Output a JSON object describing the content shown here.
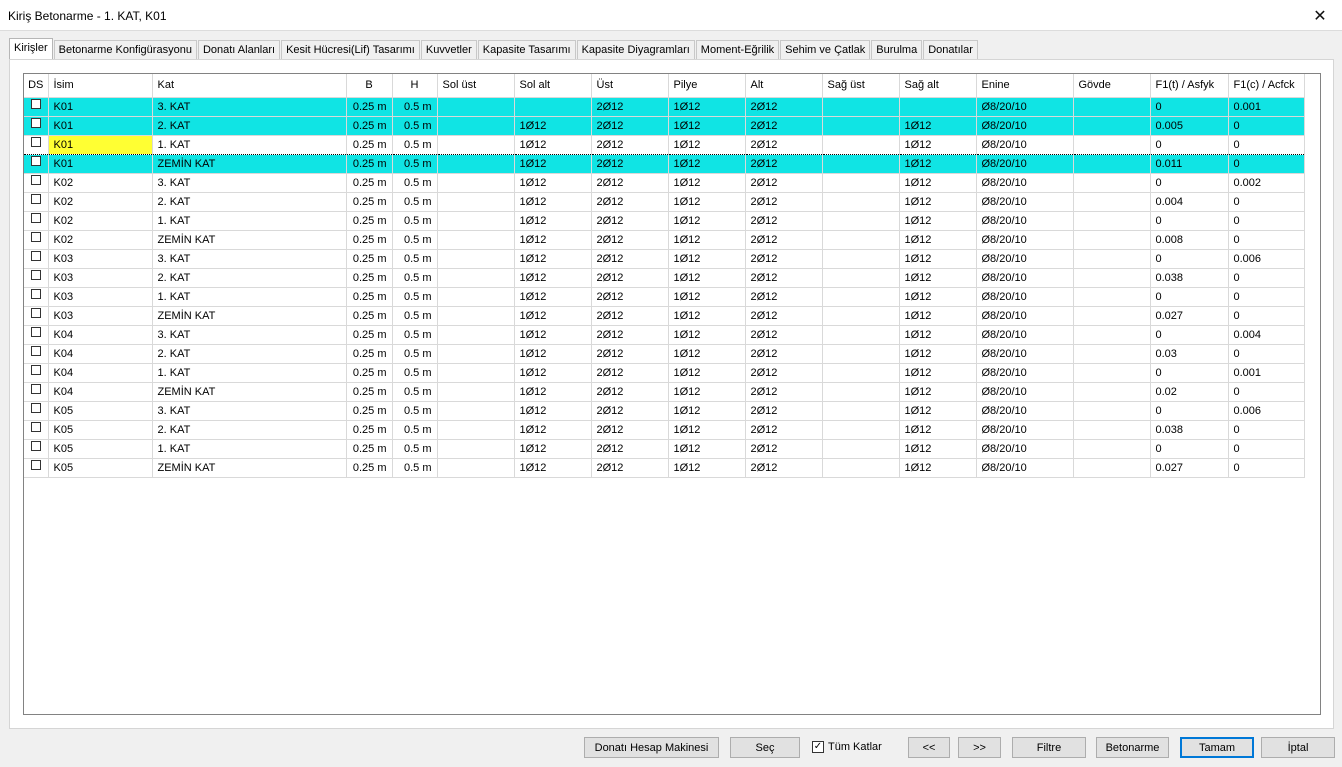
{
  "window": {
    "title": "Kiriş Betonarme - 1. KAT, K01",
    "close_glyph": "✕"
  },
  "tabs": [
    {
      "label": "Kirişler",
      "active": true
    },
    {
      "label": "Betonarme Konfigürasyonu"
    },
    {
      "label": "Donatı Alanları"
    },
    {
      "label": "Kesit Hücresi(Lif) Tasarımı"
    },
    {
      "label": "Kuvvetler"
    },
    {
      "label": "Kapasite Tasarımı"
    },
    {
      "label": "Kapasite Diyagramları"
    },
    {
      "label": "Moment-Eğrilik"
    },
    {
      "label": "Sehim ve Çatlak"
    },
    {
      "label": "Burulma"
    },
    {
      "label": "Donatılar"
    }
  ],
  "table": {
    "columns": [
      "DS",
      "İsim",
      "Kat",
      "B",
      "H",
      "Sol üst",
      "Sol alt",
      "Üst",
      "Pilye",
      "Alt",
      "Sağ üst",
      "Sağ alt",
      "Enine",
      "Gövde",
      "F1(t) / Asfyk",
      "F1(c) / Acfck"
    ],
    "rows": [
      {
        "hl": true,
        "cells": [
          "K01",
          "3. KAT",
          "0.25 m",
          "0.5 m",
          "",
          "",
          "2Ø12",
          "1Ø12",
          "2Ø12",
          "",
          "",
          "Ø8/20/10",
          "",
          "0",
          "0.001"
        ]
      },
      {
        "hl": true,
        "cells": [
          "K01",
          "2. KAT",
          "0.25 m",
          "0.5 m",
          "",
          "1Ø12",
          "2Ø12",
          "1Ø12",
          "2Ø12",
          "",
          "1Ø12",
          "Ø8/20/10",
          "",
          "0.005",
          "0"
        ]
      },
      {
        "cur": true,
        "cells": [
          "K01",
          "1. KAT",
          "0.25 m",
          "0.5 m",
          "",
          "1Ø12",
          "2Ø12",
          "1Ø12",
          "2Ø12",
          "",
          "1Ø12",
          "Ø8/20/10",
          "",
          "0",
          "0"
        ]
      },
      {
        "hl": true,
        "cells": [
          "K01",
          "ZEMİN KAT",
          "0.25 m",
          "0.5 m",
          "",
          "1Ø12",
          "2Ø12",
          "1Ø12",
          "2Ø12",
          "",
          "1Ø12",
          "Ø8/20/10",
          "",
          "0.011",
          "0"
        ]
      },
      {
        "cells": [
          "K02",
          "3. KAT",
          "0.25 m",
          "0.5 m",
          "",
          "1Ø12",
          "2Ø12",
          "1Ø12",
          "2Ø12",
          "",
          "1Ø12",
          "Ø8/20/10",
          "",
          "0",
          "0.002"
        ]
      },
      {
        "cells": [
          "K02",
          "2. KAT",
          "0.25 m",
          "0.5 m",
          "",
          "1Ø12",
          "2Ø12",
          "1Ø12",
          "2Ø12",
          "",
          "1Ø12",
          "Ø8/20/10",
          "",
          "0.004",
          "0"
        ]
      },
      {
        "cells": [
          "K02",
          "1. KAT",
          "0.25 m",
          "0.5 m",
          "",
          "1Ø12",
          "2Ø12",
          "1Ø12",
          "2Ø12",
          "",
          "1Ø12",
          "Ø8/20/10",
          "",
          "0",
          "0"
        ]
      },
      {
        "cells": [
          "K02",
          "ZEMİN KAT",
          "0.25 m",
          "0.5 m",
          "",
          "1Ø12",
          "2Ø12",
          "1Ø12",
          "2Ø12",
          "",
          "1Ø12",
          "Ø8/20/10",
          "",
          "0.008",
          "0"
        ]
      },
      {
        "cells": [
          "K03",
          "3. KAT",
          "0.25 m",
          "0.5 m",
          "",
          "1Ø12",
          "2Ø12",
          "1Ø12",
          "2Ø12",
          "",
          "1Ø12",
          "Ø8/20/10",
          "",
          "0",
          "0.006"
        ]
      },
      {
        "cells": [
          "K03",
          "2. KAT",
          "0.25 m",
          "0.5 m",
          "",
          "1Ø12",
          "2Ø12",
          "1Ø12",
          "2Ø12",
          "",
          "1Ø12",
          "Ø8/20/10",
          "",
          "0.038",
          "0"
        ]
      },
      {
        "cells": [
          "K03",
          "1. KAT",
          "0.25 m",
          "0.5 m",
          "",
          "1Ø12",
          "2Ø12",
          "1Ø12",
          "2Ø12",
          "",
          "1Ø12",
          "Ø8/20/10",
          "",
          "0",
          "0"
        ]
      },
      {
        "cells": [
          "K03",
          "ZEMİN KAT",
          "0.25 m",
          "0.5 m",
          "",
          "1Ø12",
          "2Ø12",
          "1Ø12",
          "2Ø12",
          "",
          "1Ø12",
          "Ø8/20/10",
          "",
          "0.027",
          "0"
        ]
      },
      {
        "cells": [
          "K04",
          "3. KAT",
          "0.25 m",
          "0.5 m",
          "",
          "1Ø12",
          "2Ø12",
          "1Ø12",
          "2Ø12",
          "",
          "1Ø12",
          "Ø8/20/10",
          "",
          "0",
          "0.004"
        ]
      },
      {
        "cells": [
          "K04",
          "2. KAT",
          "0.25 m",
          "0.5 m",
          "",
          "1Ø12",
          "2Ø12",
          "1Ø12",
          "2Ø12",
          "",
          "1Ø12",
          "Ø8/20/10",
          "",
          "0.03",
          "0"
        ]
      },
      {
        "cells": [
          "K04",
          "1. KAT",
          "0.25 m",
          "0.5 m",
          "",
          "1Ø12",
          "2Ø12",
          "1Ø12",
          "2Ø12",
          "",
          "1Ø12",
          "Ø8/20/10",
          "",
          "0",
          "0.001"
        ]
      },
      {
        "cells": [
          "K04",
          "ZEMİN KAT",
          "0.25 m",
          "0.5 m",
          "",
          "1Ø12",
          "2Ø12",
          "1Ø12",
          "2Ø12",
          "",
          "1Ø12",
          "Ø8/20/10",
          "",
          "0.02",
          "0"
        ]
      },
      {
        "cells": [
          "K05",
          "3. KAT",
          "0.25 m",
          "0.5 m",
          "",
          "1Ø12",
          "2Ø12",
          "1Ø12",
          "2Ø12",
          "",
          "1Ø12",
          "Ø8/20/10",
          "",
          "0",
          "0.006"
        ]
      },
      {
        "cells": [
          "K05",
          "2. KAT",
          "0.25 m",
          "0.5 m",
          "",
          "1Ø12",
          "2Ø12",
          "1Ø12",
          "2Ø12",
          "",
          "1Ø12",
          "Ø8/20/10",
          "",
          "0.038",
          "0"
        ]
      },
      {
        "cells": [
          "K05",
          "1. KAT",
          "0.25 m",
          "0.5 m",
          "",
          "1Ø12",
          "2Ø12",
          "1Ø12",
          "2Ø12",
          "",
          "1Ø12",
          "Ø8/20/10",
          "",
          "0",
          "0"
        ]
      },
      {
        "cells": [
          "K05",
          "ZEMİN KAT",
          "0.25 m",
          "0.5 m",
          "",
          "1Ø12",
          "2Ø12",
          "1Ø12",
          "2Ø12",
          "",
          "1Ø12",
          "Ø8/20/10",
          "",
          "0.027",
          "0"
        ]
      }
    ]
  },
  "footer": {
    "calc_label": "Donatı Hesap Makinesi",
    "select_label": "Seç",
    "all_floors_label": "Tüm Katlar",
    "all_floors_checked": true,
    "prev_label": "<<",
    "next_label": ">>",
    "filter_label": "Filtre",
    "concrete_label": "Betonarme",
    "ok_label": "Tamam",
    "cancel_label": "İptal"
  },
  "colors": {
    "highlight": "#10e4e4",
    "selected_cell": "#ffff33",
    "primary_border": "#0078d7"
  }
}
